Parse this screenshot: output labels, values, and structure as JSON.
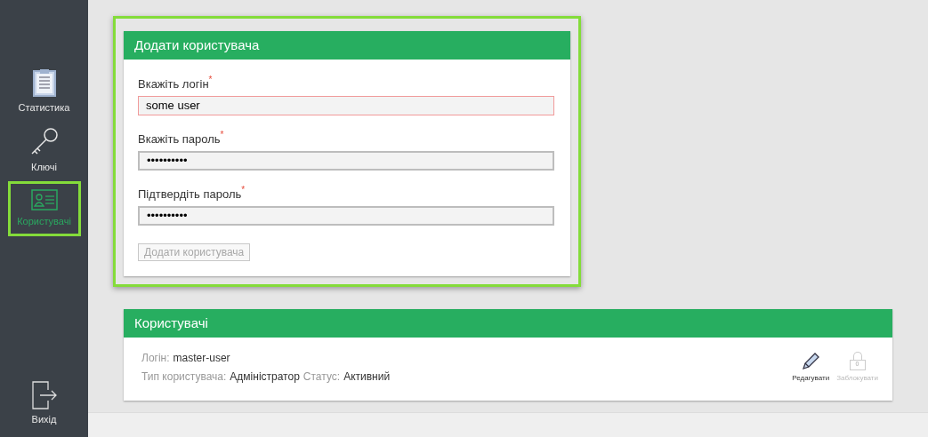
{
  "sidebar": {
    "items": [
      {
        "kind": "clipboard",
        "label": "Статистика",
        "selected": false,
        "highlighted": false
      },
      {
        "kind": "key",
        "label": "Ключі",
        "selected": false,
        "highlighted": false
      },
      {
        "kind": "id-card",
        "label": "Користувачі",
        "selected": true,
        "highlighted": true
      }
    ],
    "logout": {
      "label": "Вихід"
    }
  },
  "add_user": {
    "title": "Додати користувача",
    "highlighted": true,
    "fields": [
      {
        "label": "Вкажіть логін",
        "required_mark": "*",
        "value": "some user",
        "invalid": true
      },
      {
        "label": "Вкажіть пароль",
        "required_mark": "*",
        "value": "••••••••••",
        "invalid": false
      },
      {
        "label": "Підтвердіть пароль",
        "required_mark": "*",
        "value": "••••••••••",
        "invalid": false
      }
    ],
    "submit": {
      "label": "Додати користувача",
      "disabled": true
    }
  },
  "users": {
    "title": "Користувачі",
    "rows": [
      {
        "login_label": "Логін:",
        "login": "master-user",
        "type_label": "Тип користувача:",
        "type": "Адміністратор",
        "status_label": "Статус:",
        "status": "Активний",
        "actions": [
          {
            "kind": "edit",
            "label": "Редагувати",
            "disabled": false
          },
          {
            "kind": "lock",
            "label": "Заблокувати",
            "disabled": true,
            "badge": "0"
          }
        ]
      }
    ]
  }
}
